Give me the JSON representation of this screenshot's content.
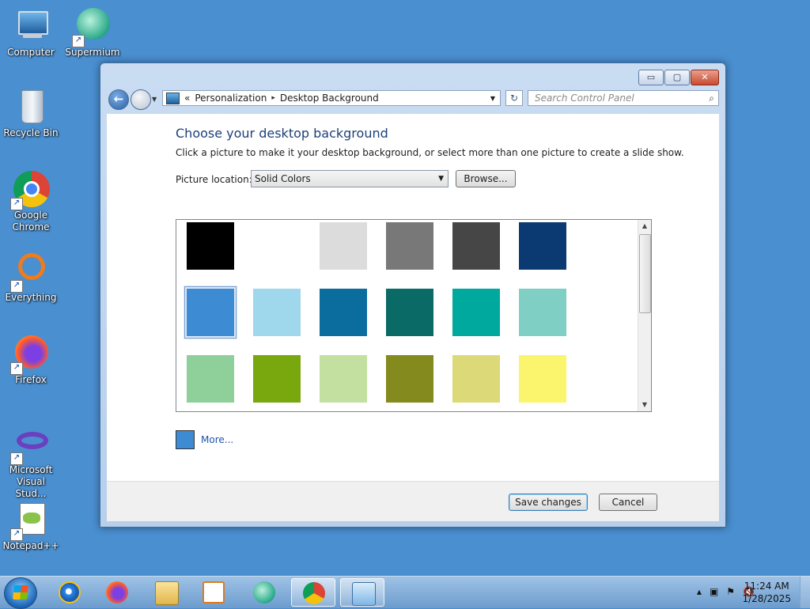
{
  "desktop": {
    "icons": [
      {
        "label": "Computer",
        "icon": "computer-icon"
      },
      {
        "label": "Supermium",
        "icon": "supermium-icon"
      },
      {
        "label": "Recycle Bin",
        "icon": "recycle-bin-icon"
      },
      {
        "label": "Google Chrome",
        "icon": "chrome-icon"
      },
      {
        "label": "Everything",
        "icon": "everything-icon"
      },
      {
        "label": "Firefox",
        "icon": "firefox-icon"
      },
      {
        "label": "Microsoft Visual Stud...",
        "icon": "visual-studio-icon"
      },
      {
        "label": "Notepad++",
        "icon": "notepadpp-icon"
      }
    ]
  },
  "window": {
    "caption_buttons": {
      "minimize": "▭",
      "maximize": "▢",
      "close": "✕"
    },
    "address": {
      "prefix": "«",
      "crumbs": [
        "Personalization",
        "Desktop Background"
      ],
      "separator": "▸"
    },
    "search_placeholder": "Search Control Panel",
    "title": "Choose your desktop background",
    "subtitle": "Click a picture to make it your desktop background, or select more than one picture to create a slide show.",
    "picture_location_label": "Picture location:",
    "picture_location_value": "Solid Colors",
    "browse_label": "Browse...",
    "colors": [
      "#000000",
      "#ffffff",
      "#dcdcdc",
      "#787878",
      "#464646",
      "#0b3a73",
      "#3d8bd2",
      "#9fd8ec",
      "#0a6d9e",
      "#0a6a66",
      "#00a99d",
      "#7fcfc4",
      "#8fcf9a",
      "#78a80e",
      "#c4e0a0",
      "#858a1e",
      "#dcd978",
      "#fbf46d"
    ],
    "selected_color": "#3d8bd2",
    "more_label": "More...",
    "save_label": "Save changes",
    "cancel_label": "Cancel"
  },
  "taskbar": {
    "items": [
      "start-button",
      "internet-explorer-icon",
      "firefox-icon",
      "file-explorer-icon",
      "media-player-icon",
      "supermium-icon",
      "chrome-icon",
      "control-panel-icon"
    ],
    "active_item": "control-panel-icon",
    "tray_icons": [
      "show-hidden-icons",
      "network-icon",
      "action-center-flag-icon",
      "volume-muted-icon"
    ],
    "time": "11:24 AM",
    "date": "1/28/2025"
  }
}
